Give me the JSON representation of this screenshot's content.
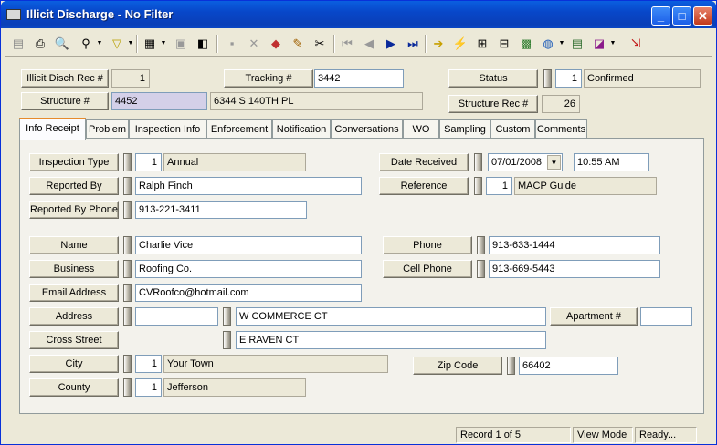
{
  "window": {
    "title": "Illicit Discharge - No Filter",
    "minimize": "_",
    "maximize": "□",
    "close": "✕"
  },
  "toolbar_icons": [
    "new-record-icon",
    "print-icon",
    "print-preview-icon",
    "binoculars-icon",
    "filter-icon",
    "report-icon",
    "copy-form-icon",
    "paste-form-icon",
    "save-icon",
    "delete-icon",
    "palette-icon",
    "pencil-icon",
    "scissors-icon",
    "first-record-icon",
    "previous-record-icon",
    "next-record-icon",
    "last-record-icon",
    "go-arrow-icon",
    "lightning-icon",
    "tree-icon",
    "org-chart-icon",
    "map-icon",
    "globe-icon",
    "calculator-icon",
    "book-icon",
    "exit-icon"
  ],
  "header": {
    "illicit_label": "Illicit Disch Rec #",
    "illicit_value": "1",
    "tracking_label": "Tracking #",
    "tracking_value": "3442",
    "status_label": "Status",
    "status_code": "1",
    "status_value": "Confirmed",
    "structure_label": "Structure #",
    "structure_value": "4452",
    "structure_address": "6344  S  140TH PL",
    "structure_rec_label": "Structure Rec #",
    "structure_rec_value": "26"
  },
  "tabs": [
    "Info Receipt",
    "Problem",
    "Inspection Info",
    "Enforcement",
    "Notification",
    "Conversations",
    "WO",
    "Sampling",
    "Custom",
    "Comments"
  ],
  "form": {
    "inspection_type_label": "Inspection Type",
    "inspection_type_code": "1",
    "inspection_type_value": "Annual",
    "date_received_label": "Date Received",
    "date_received_value": "07/01/2008",
    "time_received_value": "10:55 AM",
    "reported_by_label": "Reported By",
    "reported_by_value": "Ralph Finch",
    "reference_label": "Reference",
    "reference_code": "1",
    "reference_value": "MACP Guide",
    "reported_phone_label": "Reported By Phone",
    "reported_phone_value": "913-221-3411",
    "name_label": "Name",
    "name_value": "Charlie Vice",
    "phone_label": "Phone",
    "phone_value": "913-633-1444",
    "business_label": "Business",
    "business_value": "Roofing Co.",
    "cell_label": "Cell Phone",
    "cell_value": "913-669-5443",
    "email_label": "Email Address",
    "email_value": "CVRoofco@hotmail.com",
    "address_label": "Address",
    "address_number": "",
    "address_street": "W COMMERCE CT",
    "apartment_label": "Apartment #",
    "apartment_value": "",
    "cross_label": "Cross Street",
    "cross_value": "E RAVEN CT",
    "city_label": "City",
    "city_code": "1",
    "city_value": "Your Town",
    "zip_label": "Zip Code",
    "zip_value": "66402",
    "county_label": "County",
    "county_code": "1",
    "county_value": "Jefferson"
  },
  "status": {
    "record": "Record 1 of 5",
    "mode": "View Mode",
    "state": "Ready..."
  }
}
